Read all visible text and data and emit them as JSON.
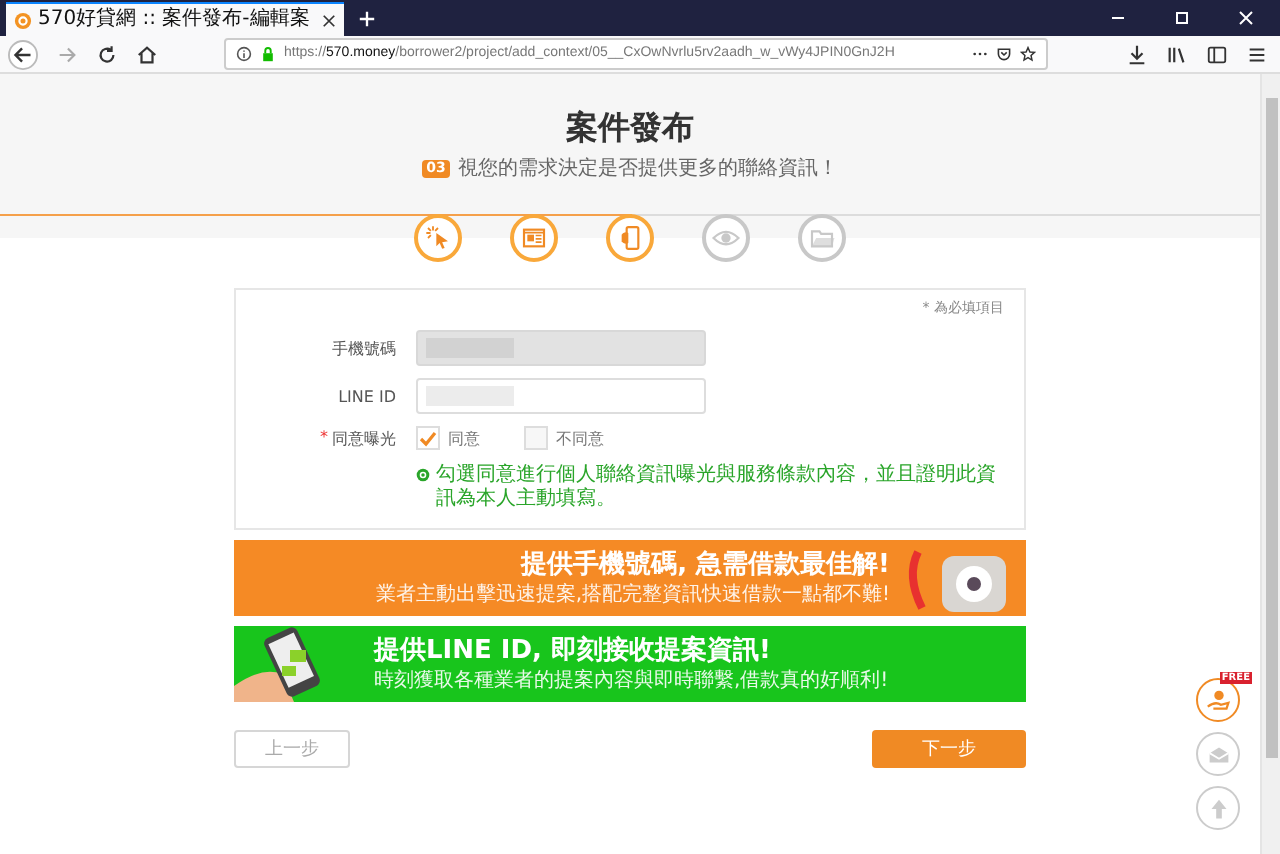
{
  "browser": {
    "tab": {
      "title": "570好貸網 :: 案件發布-編輯案",
      "selected": true
    },
    "url": {
      "scheme": "https://",
      "domain": "570.money",
      "path": "/borrower2/project/add_context/05__CxOwNvrlu5rv2aadh_w_vWy4JPIN0GnJ2H"
    }
  },
  "header": {
    "title": "案件發布",
    "badge": "03",
    "subtitle": "視您的需求決定是否提供更多的聯絡資訊！"
  },
  "steps": [
    {
      "done": true
    },
    {
      "done": true
    },
    {
      "done": true
    },
    {
      "done": false
    },
    {
      "done": false
    }
  ],
  "form": {
    "required_note": "* 為必填項目",
    "fields": [
      {
        "label": "手機號碼",
        "disabled": true
      },
      {
        "label": "LINE ID",
        "disabled": false
      }
    ],
    "consent": {
      "mark": "*",
      "label": "同意曝光",
      "options": [
        {
          "label": "同意",
          "checked": true
        },
        {
          "label": "不同意",
          "checked": false
        }
      ],
      "note": "勾選同意進行個人聯絡資訊曝光與服務條款內容，並且證明此資訊為本人主動填寫。"
    }
  },
  "banners": [
    {
      "kind": "phone",
      "title": "提供手機號碼, 急需借款最佳解!",
      "subtitle": "業者主動出擊迅速提案,搭配完整資訊快速借款一點都不難!"
    },
    {
      "kind": "line",
      "title": "提供LINE ID, 即刻接收提案資訊!",
      "subtitle": "時刻獲取各種業者的提案內容與即時聯繫,借款真的好順利!"
    }
  ],
  "buttons": {
    "prev": "上一步",
    "next": "下一步"
  },
  "side": {
    "badge": "FREE"
  }
}
